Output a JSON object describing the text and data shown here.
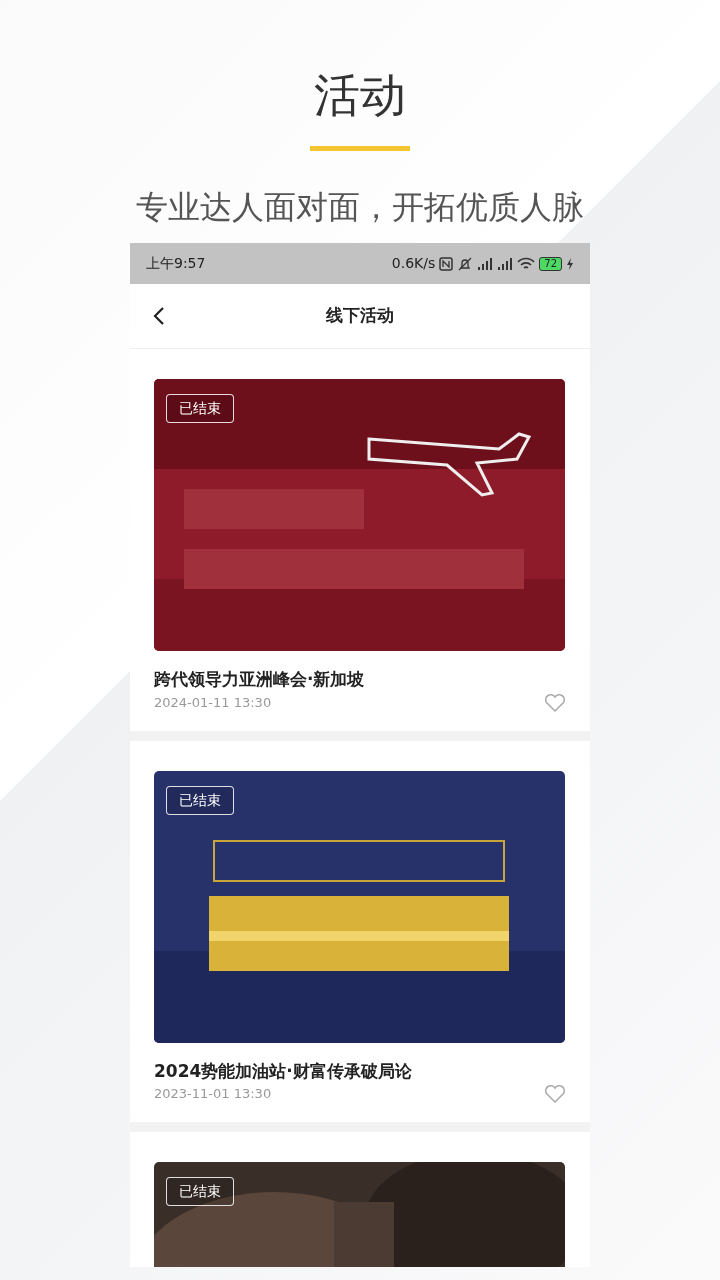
{
  "promo": {
    "title": "活动",
    "subtitle": "专业达人面对面，开拓优质人脉"
  },
  "status_bar": {
    "time": "上午9:57",
    "speed": "0.6K/s",
    "battery": "72"
  },
  "nav": {
    "title": "线下活动"
  },
  "events": [
    {
      "badge": "已结束",
      "title": "跨代领导力亚洲峰会·新加坡",
      "date": "2024-01-11 13:30"
    },
    {
      "badge": "已结束",
      "title": "2024势能加油站·财富传承破局论",
      "date": "2023-11-01 13:30"
    },
    {
      "badge": "已结束"
    }
  ]
}
